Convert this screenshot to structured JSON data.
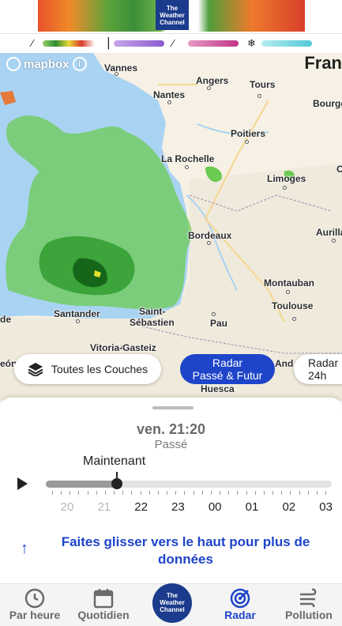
{
  "ad": {
    "logo_line1": "The",
    "logo_line2": "Weather",
    "logo_line3": "Channel"
  },
  "legend": [
    {
      "icon": "rain-icon",
      "gradient": "linear-gradient(90deg,#9ad06a,#2e8c32,#e9d73a,#d83a2a,#fff)"
    },
    {
      "icon": "mix-icon",
      "gradient": "linear-gradient(90deg,#c7a6e8,#8a5bd0)"
    },
    {
      "icon": "sleet-icon",
      "gradient": "linear-gradient(90deg,#e79ac4,#c0348a)"
    },
    {
      "icon": "snow-icon",
      "gradient": "linear-gradient(90deg,#b4ecf0,#4fc9d6)"
    }
  ],
  "map": {
    "mapbox_label": "mapbox",
    "country": "Fran",
    "cities": [
      {
        "name": "Vannes"
      },
      {
        "name": "Angers"
      },
      {
        "name": "Tours"
      },
      {
        "name": "Bourge"
      },
      {
        "name": "Nantes"
      },
      {
        "name": "Poitiers"
      },
      {
        "name": "La Rochelle"
      },
      {
        "name": "Limoges"
      },
      {
        "name": "Bordeaux"
      },
      {
        "name": "Aurilla"
      },
      {
        "name": "Montauban"
      },
      {
        "name": "Toulouse"
      },
      {
        "name": "Santander"
      },
      {
        "name": "Saint-"
      },
      {
        "name": "Sébastien"
      },
      {
        "name": "Pau"
      },
      {
        "name": "Vitoria-Gasteiz"
      },
      {
        "name": "Huesca"
      },
      {
        "name": "de"
      },
      {
        "name": "eón"
      },
      {
        "name": "And"
      },
      {
        "name": "C"
      }
    ]
  },
  "buttons": {
    "layers": "Toutes les Couches",
    "radar_line1": "Radar",
    "radar_line2": "Passé & Futur",
    "radar2_line1": "Radar I",
    "radar2_line2": "24h"
  },
  "timeline": {
    "time": "ven. 21:20",
    "state": "Passé",
    "now_label": "Maintenant",
    "progress": 0.25,
    "hours": [
      "20",
      "21",
      "22",
      "23",
      "00",
      "01",
      "02",
      "03"
    ],
    "past_count": 2
  },
  "swipe": {
    "line1": "Faites glisser vers le haut pour plus de",
    "line2": "données"
  },
  "nav": {
    "hourly": "Par heure",
    "daily": "Quotidien",
    "logo_line1": "The",
    "logo_line2": "Weather",
    "logo_line3": "Channel",
    "radar": "Radar",
    "pollution": "Pollution"
  }
}
